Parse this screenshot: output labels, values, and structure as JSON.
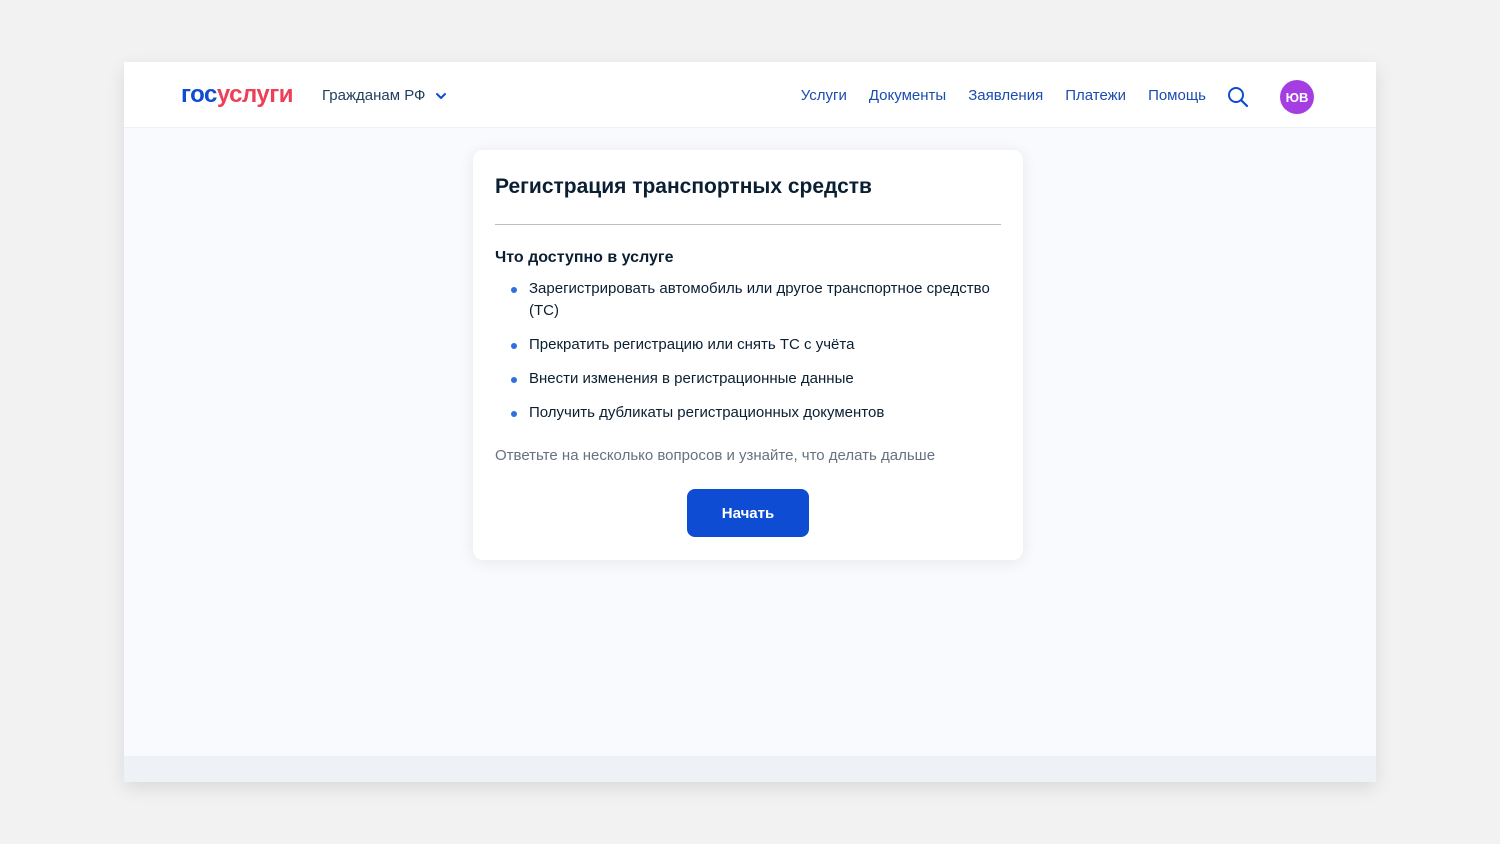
{
  "header": {
    "logo_part1": "гос",
    "logo_part2": "услуги",
    "citizens_label": "Гражданам РФ",
    "nav": [
      {
        "label": "Услуги"
      },
      {
        "label": "Документы"
      },
      {
        "label": "Заявления"
      },
      {
        "label": "Платежи"
      },
      {
        "label": "Помощь"
      }
    ],
    "avatar_initials": "ЮВ"
  },
  "card": {
    "title": "Регистрация транспортных средств",
    "section_title": "Что доступно в услуге",
    "items": [
      {
        "text": "Зарегистрировать автомобиль или другое транспортное средство (ТС)"
      },
      {
        "text": "Прекратить регистрацию или снять ТС с учёта"
      },
      {
        "text": "Внести изменения в регистрационные данные"
      },
      {
        "text": "Получить дубликаты регистрационных документов"
      }
    ],
    "hint": "Ответьте на несколько вопросов и узнайте, что делать дальше",
    "start_label": "Начать"
  },
  "colors": {
    "primary": "#0d4cd3",
    "logo_red": "#ee3f58",
    "avatar": "#a43ee3",
    "bullet": "#2f6fe0"
  },
  "icons": {
    "search": "search-icon",
    "dropdown": "chevron-down-icon"
  }
}
